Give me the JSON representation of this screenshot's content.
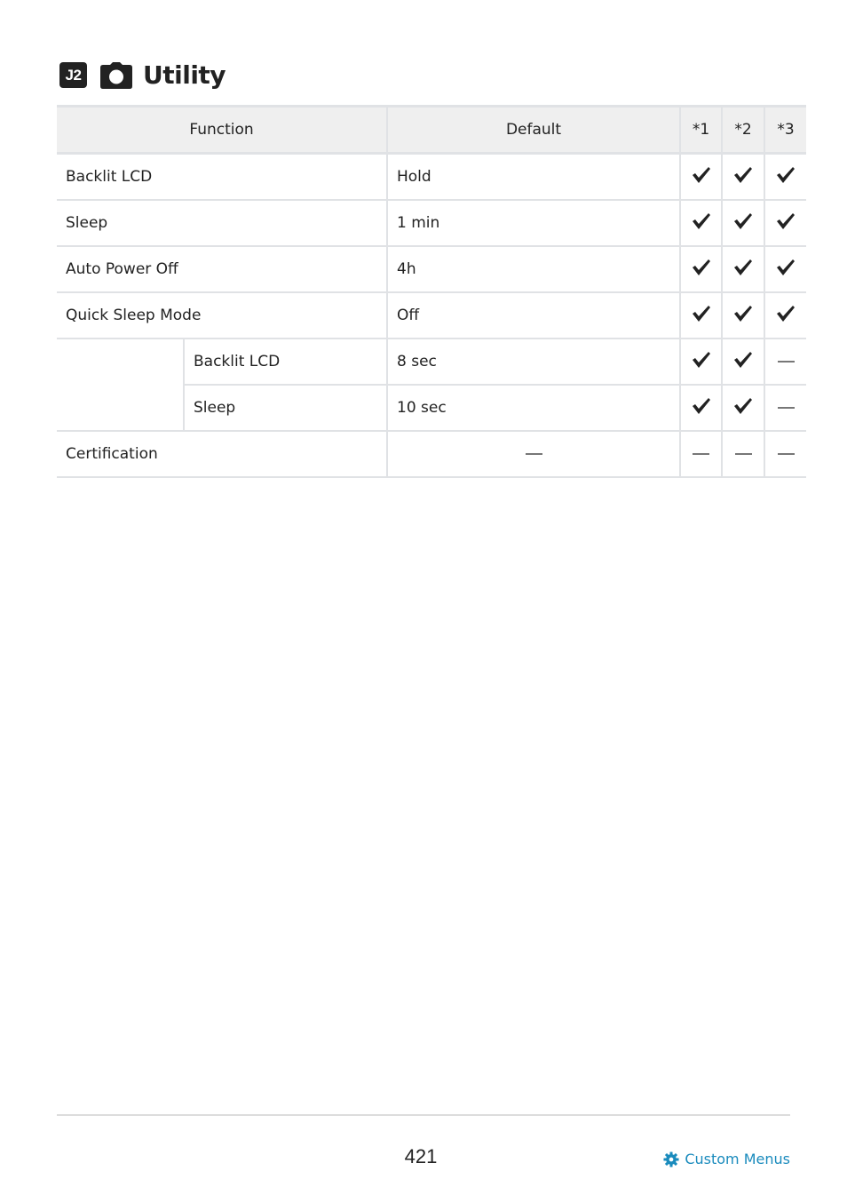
{
  "heading": {
    "badge": "J2",
    "icon": "camera-icon",
    "title": "Utility"
  },
  "table": {
    "headers": [
      "Function",
      "Default",
      "*1",
      "*2",
      "*3"
    ],
    "rows": [
      {
        "function": "Backlit LCD",
        "default": "Hold",
        "c1": "check",
        "c2": "check",
        "c3": "check"
      },
      {
        "function": "Sleep",
        "default": "1 min",
        "c1": "check",
        "c2": "check",
        "c3": "check"
      },
      {
        "function": "Auto Power Off",
        "default": "4h",
        "c1": "check",
        "c2": "check",
        "c3": "check"
      },
      {
        "function": "Quick Sleep Mode",
        "default": "Off",
        "c1": "check",
        "c2": "check",
        "c3": "check"
      },
      {
        "function": "",
        "sub": "Backlit LCD",
        "default": "8 sec",
        "c1": "check",
        "c2": "check",
        "c3": "dash"
      },
      {
        "function": "",
        "sub": "Sleep",
        "default": "10 sec",
        "c1": "check",
        "c2": "check",
        "c3": "dash"
      },
      {
        "function": "Certification",
        "default": "—",
        "c1": "dash",
        "c2": "dash",
        "c3": "dash"
      }
    ]
  },
  "footer": {
    "page_number": "421",
    "link_label": "Custom Menus",
    "link_icon": "gear-icon",
    "link_color": "#1a8bbd"
  }
}
